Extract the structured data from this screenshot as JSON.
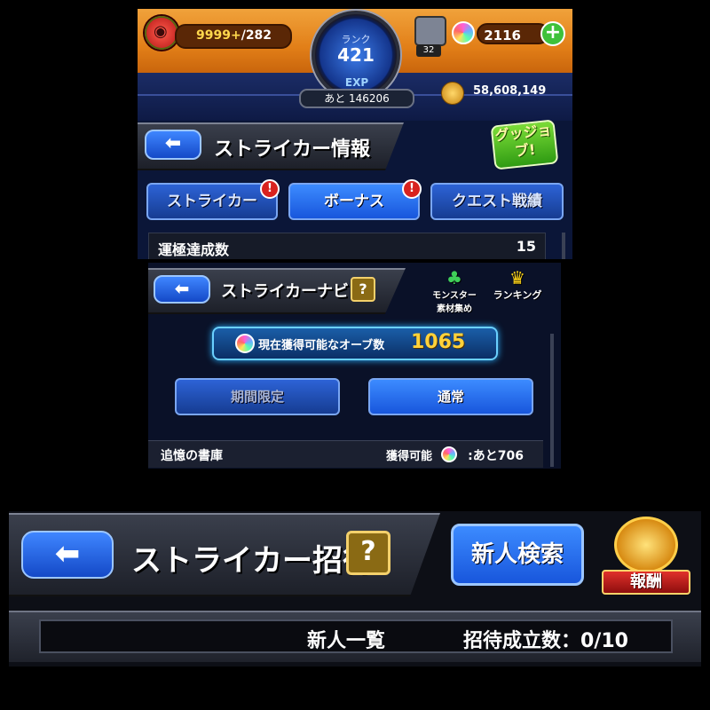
{
  "panel1": {
    "stamina": {
      "current": "9999+",
      "max": "/282"
    },
    "rank": {
      "label": "ランク",
      "value": "421"
    },
    "exp": {
      "label": "EXP",
      "remaining": "あと 146206"
    },
    "box_count": "32",
    "orbs": "2116",
    "gold": "58,608,149",
    "header_title": "ストライカー情報",
    "good_job": "グッジョブ!",
    "tabs": [
      {
        "label": "ストライカー",
        "alert": "!"
      },
      {
        "label": "ボーナス",
        "alert": "!"
      },
      {
        "label": "クエスト戦績"
      }
    ],
    "row": {
      "label": "運極達成数",
      "value": "15"
    }
  },
  "panel2": {
    "header_title": "ストライカーナビ",
    "help": "?",
    "monster_materials": [
      "モンスター",
      "素材集め"
    ],
    "ranking": "ランキング",
    "orb_panel": {
      "label": "現在獲得可能なオーブ数",
      "value": "1065"
    },
    "buttons": [
      "期間限定",
      "通常"
    ],
    "row": {
      "label": "追憶の書庫",
      "prefix": "獲得可能",
      "value": ":あと706"
    }
  },
  "panel3": {
    "header_title": "ストライカー招待",
    "help": "?",
    "search_button": "新人検索",
    "reward": "報酬",
    "list_label": "新人一覧",
    "invite_count": "招待成立数：0/10"
  },
  "colors": {
    "accent_blue": "#1856dc",
    "orange_bar": "#e27f18",
    "gold_text": "#ffd23a"
  }
}
